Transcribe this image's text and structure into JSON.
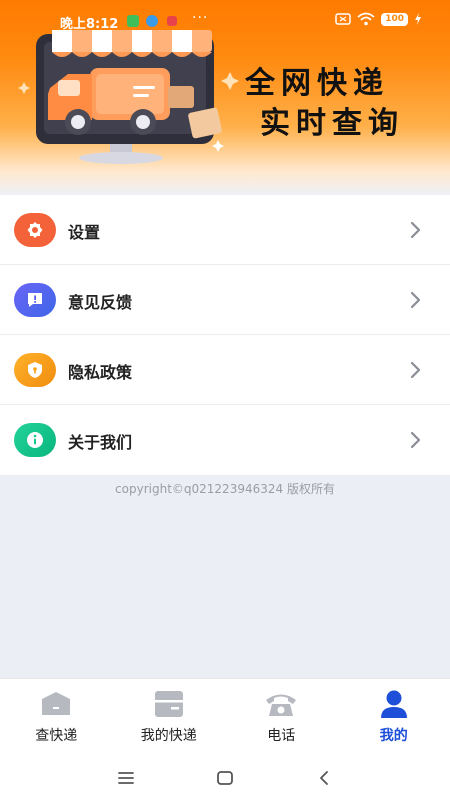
{
  "status_bar": {
    "time": "晚上8:12",
    "more": "···",
    "battery": "100",
    "icons": [
      "sim-icon",
      "message-icon",
      "notification-icon",
      "screen-icon",
      "wifi-icon",
      "battery-icon",
      "charging-icon"
    ]
  },
  "banner": {
    "title_line1": "全网快递",
    "title_line2": "实时查询",
    "illustration": "delivery-truck-shop-illustration"
  },
  "menu": {
    "items": [
      {
        "label": "设置",
        "icon": "gear-icon",
        "color": "#f4623a"
      },
      {
        "label": "意见反馈",
        "icon": "feedback-icon",
        "color": "#5b5ef0"
      },
      {
        "label": "隐私政策",
        "icon": "shield-icon",
        "color": "#f6a21a"
      },
      {
        "label": "关于我们",
        "icon": "info-icon",
        "color": "#12c98b"
      }
    ]
  },
  "footer": {
    "copyright": "copyright©q021223946324 版权所有"
  },
  "tabbar": {
    "tabs": [
      {
        "label": "查快递",
        "icon": "package-icon",
        "active": false
      },
      {
        "label": "我的快递",
        "icon": "box-icon",
        "active": false
      },
      {
        "label": "电话",
        "icon": "phone-icon",
        "active": false
      },
      {
        "label": "我的",
        "icon": "user-icon",
        "active": true
      }
    ],
    "active_color": "#1e4fd9"
  },
  "colors": {
    "banner_orange": "#ff7a00",
    "background": "#ebeef5"
  }
}
